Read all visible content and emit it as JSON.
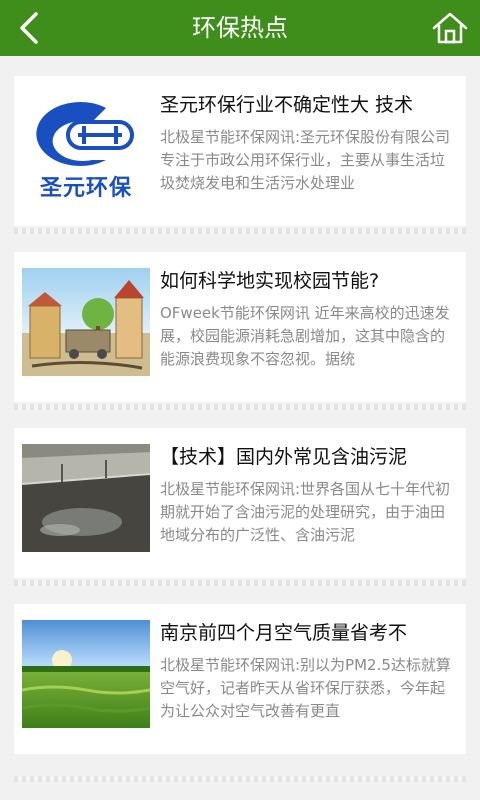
{
  "header": {
    "title": "环保热点",
    "back_icon": "chevron-left-icon",
    "home_icon": "home-icon",
    "bg_color": "#3f8e1c"
  },
  "articles": [
    {
      "title": "圣元环保行业不确定性大 技术",
      "desc": "北极星节能环保网讯:圣元环保股份有限公司专注于市政公用环保行业，主要从事生活垃圾焚烧发电和生活污水处理业",
      "logo_text": "圣元环保"
    },
    {
      "title": "如何科学地实现校园节能?",
      "desc": "OFweek节能环保网讯 近年来高校的迅速发展，校园能源消耗急剧增加，这其中隐含的能源浪费现象不容忽视。据统"
    },
    {
      "title": "【技术】国内外常见含油污泥",
      "desc": "北极星节能环保网讯:世界各国从七十年代初期就开始了含油污泥的处理研究，由于油田地域分布的广泛性、含油污泥"
    },
    {
      "title": "南京前四个月空气质量省考不",
      "desc": "北极星节能环保网讯:别以为PM2.5达标就算空气好，记者昨天从省环保厅获悉，今年起为让公众对空气改善有更直"
    }
  ]
}
